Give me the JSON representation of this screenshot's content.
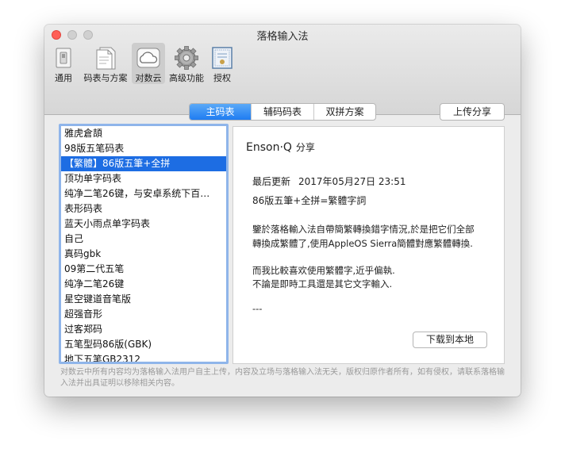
{
  "window": {
    "title": "落格输入法"
  },
  "toolbar": {
    "items": [
      {
        "label": "通用",
        "icon": "switch-icon"
      },
      {
        "label": "码表与方案",
        "icon": "documents-icon"
      },
      {
        "label": "对数云",
        "icon": "cloud-icon",
        "active": true
      },
      {
        "label": "高级功能",
        "icon": "gear-icon"
      },
      {
        "label": "授权",
        "icon": "certificate-icon"
      }
    ]
  },
  "tabs": [
    {
      "label": "主码表",
      "active": true
    },
    {
      "label": "辅码码表"
    },
    {
      "label": "双拼方案"
    }
  ],
  "upload_label": "上传分享",
  "list": {
    "items": [
      "雅虎倉頡",
      "98版五笔码表",
      "【繁體】86版五筆+全拼",
      "顶功单字码表",
      "纯净二笔26键，与安卓系统下百…",
      "表形码表",
      "蓝天小雨点单字码表",
      "自己",
      "真码gbk",
      "09第二代五笔",
      "纯净二笔26键",
      "星空键道音笔版",
      "超强音形",
      "过客郑码",
      "五笔型码86版(GBK)",
      "地下五笔GB2312"
    ],
    "selected_index": 2
  },
  "detail": {
    "author": "Enson·Q",
    "share_suffix": "分享",
    "updated_label": "最后更新",
    "updated_date": "2017年05月27日 23:51",
    "title": "86版五筆+全拼=繁體字詞",
    "body_lines": [
      "鑒於落格輸入法自帶簡繁轉換錯字情況,於是把它们全部",
      "轉換成繁體了,使用AppleOS Sierra簡體對應繁體轉換.",
      "",
      "而我比較喜欢使用繁體字,近乎偏執.",
      "不論是即時工具還是其它文字輸入.",
      "",
      "---"
    ],
    "download_label": "下载到本地"
  },
  "disclaimer": "对数云中所有内容均为落格输入法用户自主上传，内容及立场与落格输入法无关，版权归原作者所有，如有侵权，请联系落格输入法并出具证明以移除相关内容。",
  "colors": {
    "accent": "#1f7cf2",
    "selection": "#1d6de3",
    "close": "#ff5f57"
  }
}
